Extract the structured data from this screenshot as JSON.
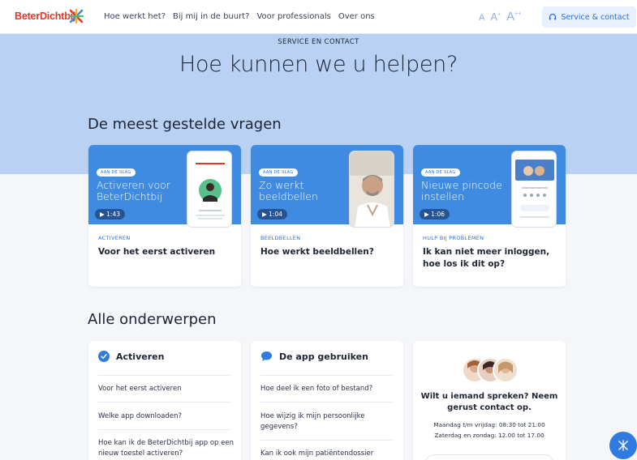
{
  "header": {
    "logo_text": "BeterDichtbij",
    "nav": [
      "Hoe werkt het?",
      "Bij mij in de buurt?",
      "Voor professionals",
      "Over ons"
    ],
    "font_size_options": [
      "A",
      "A",
      "A"
    ],
    "font_size_sup": [
      "",
      "+",
      "++"
    ],
    "service_button": "Service & contact"
  },
  "hero": {
    "eyebrow": "SERVICE EN CONTACT",
    "title": "Hoe kunnen we u helpen?"
  },
  "faq": {
    "heading": "De meest gestelde vragen",
    "cards": [
      {
        "badge": "AAN DE SLAG",
        "media_title": "Activeren voor BeterDichtbij",
        "duration": "▶ 1:43",
        "category": "ACTIVEREN",
        "question": "Voor het eerst activeren"
      },
      {
        "badge": "AAN DE SLAG",
        "media_title": "Zo werkt beeldbellen",
        "duration": "▶ 1:04",
        "category": "BEELDBELLEN",
        "question": "Hoe werkt beeldbellen?"
      },
      {
        "badge": "AAN DE SLAG",
        "media_title": "Nieuwe pincode instellen",
        "duration": "▶ 1:06",
        "category": "HULP BIJ PROBLEMEN",
        "question": "Ik kan niet meer inloggen, hoe los ik dit op?"
      }
    ]
  },
  "topics": {
    "heading": "Alle onderwerpen",
    "panels": [
      {
        "title": "Activeren",
        "items": [
          "Voor het eerst activeren",
          "Welke app downloaden?",
          "Hoe kan ik de BeterDichtbij app op een nieuw toestel activeren?"
        ]
      },
      {
        "title": "De app gebruiken",
        "items": [
          "Hoe deel ik een foto of bestand?",
          "Hoe wijzig ik mijn persoonlijke gegevens?",
          "Kan ik ook mijn patiëntendossier"
        ]
      }
    ],
    "contact": {
      "title": "Wilt u iemand spreken? Neem gerust contact op.",
      "hours_weekday": "Maandag t/m vrijdag: 08:30 tot 21:00",
      "hours_weekend": "Zaterdag en zondag: 12.00 tot 17.00"
    }
  },
  "colors": {
    "brand_red": "#e3362a",
    "accent_blue": "#2f7be0",
    "hero_bg": "#b9d2f3"
  }
}
